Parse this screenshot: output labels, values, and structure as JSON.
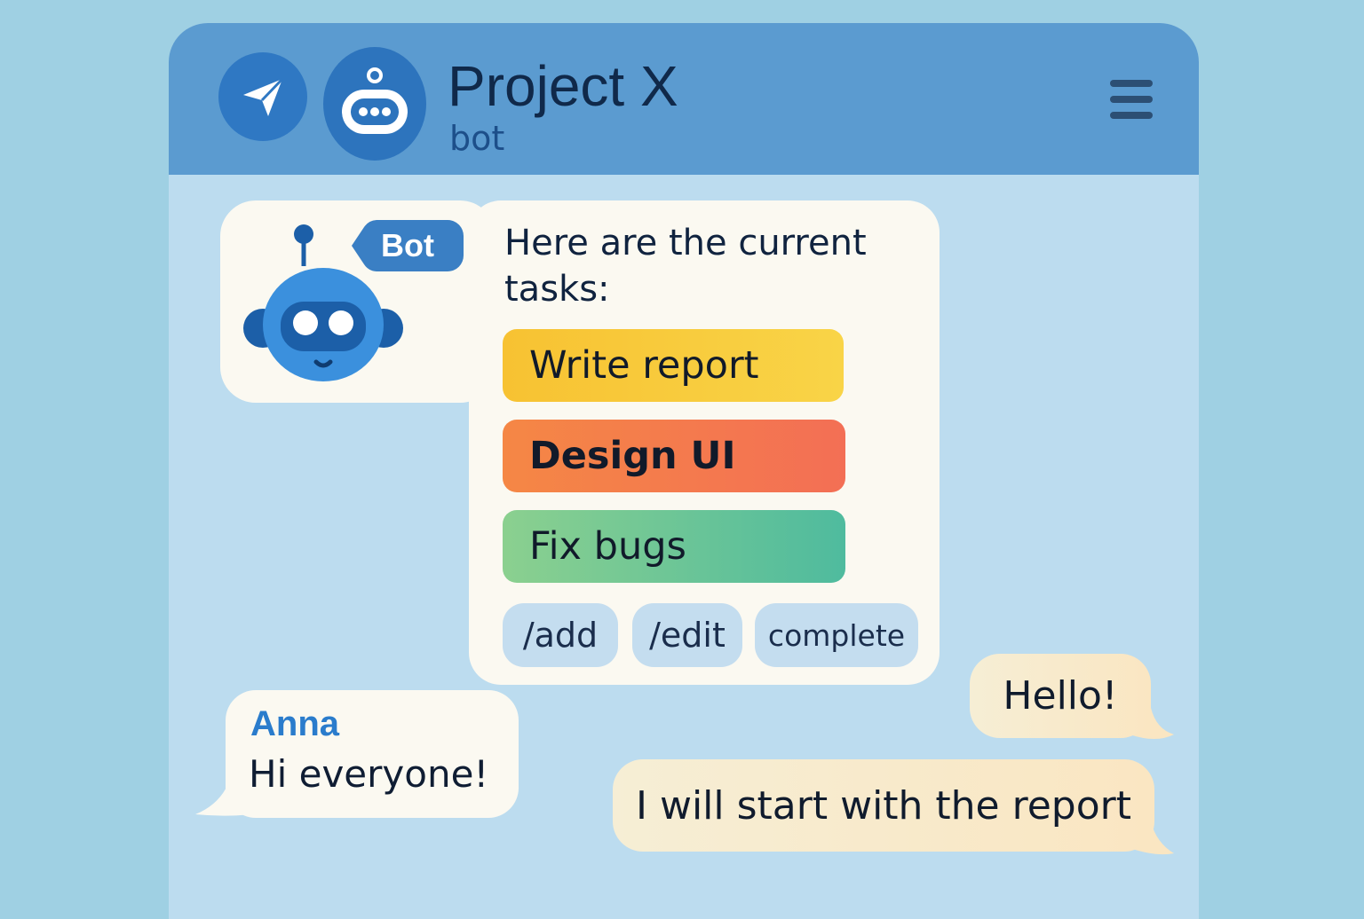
{
  "header": {
    "title": "Project X",
    "subtitle": "bot",
    "app_icon": "telegram-plane-icon",
    "avatar_icon": "robot-avatar-icon",
    "menu_icon": "hamburger-menu-icon"
  },
  "bot_message": {
    "sender_badge": "Bot",
    "intro": "Here are the current tasks:",
    "tasks": [
      {
        "label": "Write report",
        "color": "#f7c232"
      },
      {
        "label": "Design UI",
        "color": "#f47a4f"
      },
      {
        "label": "Fix bugs",
        "color": "#5fc29b"
      }
    ],
    "commands": [
      "/add",
      "/edit",
      "complete"
    ]
  },
  "anna_message": {
    "sender": "Anna",
    "text": "Hi everyone!"
  },
  "own_messages": [
    {
      "text": "Hello!"
    },
    {
      "text": "I will start with the report"
    }
  ],
  "colors": {
    "background": "#9fd0e3",
    "header": "#5b9bd0",
    "chat_area": "#bcdcef",
    "bubble": "#fbf9f1",
    "own_bubble": "#f8eacb",
    "accent": "#2a7ccc"
  }
}
